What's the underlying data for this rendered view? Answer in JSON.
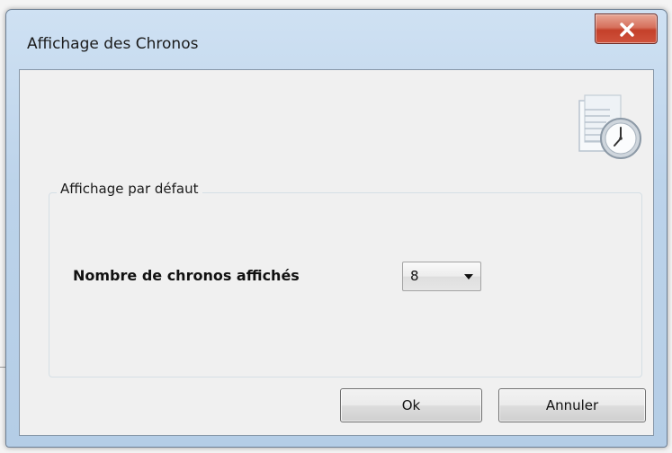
{
  "window": {
    "title": "Affichage des Chronos"
  },
  "group": {
    "legend": "Affichage par défaut"
  },
  "field": {
    "label": "Nombre de chronos affichés",
    "selected_value": "8"
  },
  "buttons": {
    "ok_label": "Ok",
    "cancel_label": "Annuler"
  },
  "icons": {
    "close": "close-icon",
    "app": "clock-document-icon",
    "dropdown": "chevron-down-icon"
  },
  "colors": {
    "title_bar": "#bcd3ea",
    "close_button": "#c4402a",
    "client_background": "#f0f0f0"
  }
}
